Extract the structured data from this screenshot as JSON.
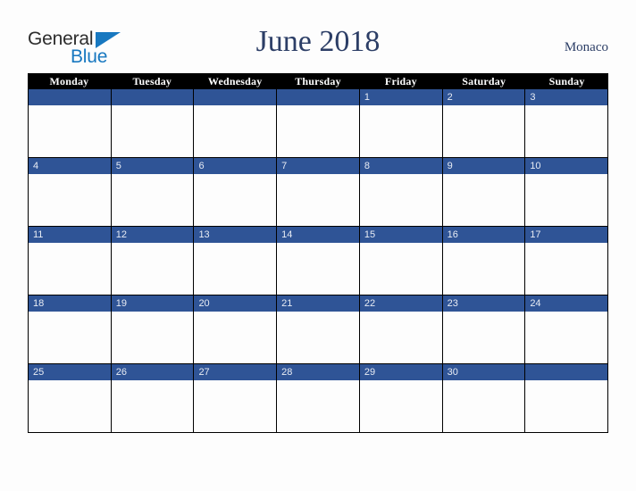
{
  "brand": {
    "name_part1": "General",
    "name_part2": "Blue",
    "triangle_icon": "blue-triangle-icon",
    "colors": {
      "text_dark": "#2d2d2d",
      "accent_blue": "#1878c0"
    }
  },
  "header": {
    "title": "June 2018",
    "location": "Monaco",
    "title_color": "#2c3e66"
  },
  "calendar": {
    "month": "June",
    "year": "2018",
    "week_start": "Monday",
    "colors": {
      "band_blue": "#2f5496",
      "header_bg": "#000000",
      "header_text": "#ffffff",
      "cell_bg": "#fdfdfd",
      "grid_line": "#000000",
      "day_number": "#e8ecf4"
    },
    "weekdays": [
      "Monday",
      "Tuesday",
      "Wednesday",
      "Thursday",
      "Friday",
      "Saturday",
      "Sunday"
    ],
    "weeks": [
      [
        "",
        "",
        "",
        "",
        "1",
        "2",
        "3"
      ],
      [
        "4",
        "5",
        "6",
        "7",
        "8",
        "9",
        "10"
      ],
      [
        "11",
        "12",
        "13",
        "14",
        "15",
        "16",
        "17"
      ],
      [
        "18",
        "19",
        "20",
        "21",
        "22",
        "23",
        "24"
      ],
      [
        "25",
        "26",
        "27",
        "28",
        "29",
        "30",
        ""
      ]
    ]
  }
}
